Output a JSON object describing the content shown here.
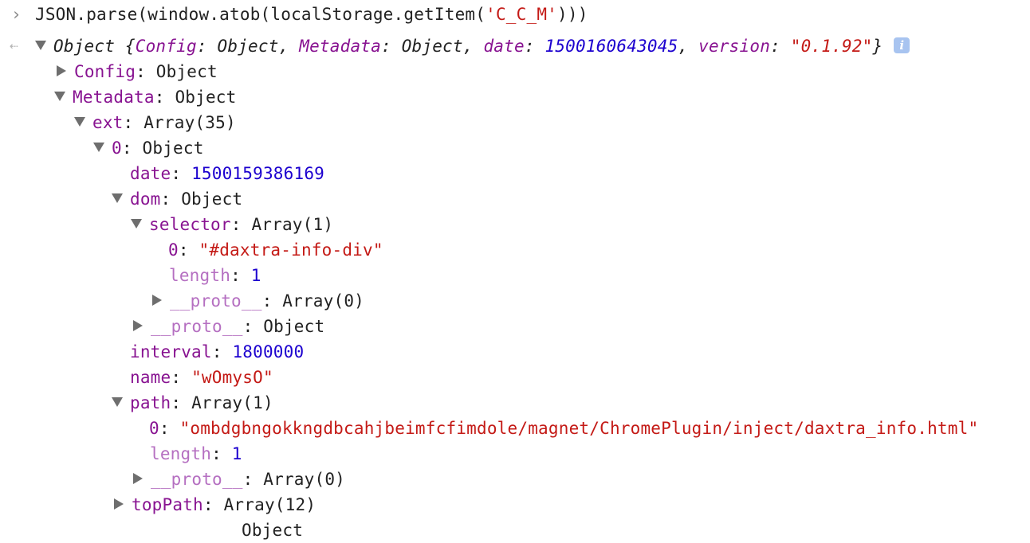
{
  "command": {
    "prefix": "JSON.parse(window.atob(localStorage.getItem(",
    "arg": "'C_C_M'",
    "suffix": ")))"
  },
  "preview": {
    "open": "Object {",
    "k1": "Config",
    "v1": "Object",
    "k2": "Metadata",
    "v2": "Object",
    "k3": "date",
    "v3": "1500160643045",
    "k4": "version",
    "v4": "\"0.1.92\"",
    "close": "}",
    "info": "i"
  },
  "tree": {
    "config": {
      "key": "Config",
      "value": "Object"
    },
    "metadata": {
      "key": "Metadata",
      "value": "Object"
    },
    "ext": {
      "key": "ext",
      "value": "Array(35)"
    },
    "item0": {
      "key": "0",
      "value": "Object"
    },
    "date": {
      "key": "date",
      "value": "1500159386169"
    },
    "dom": {
      "key": "dom",
      "value": "Object"
    },
    "selector": {
      "key": "selector",
      "value": "Array(1)"
    },
    "selector0": {
      "key": "0",
      "value": "\"#daxtra-info-div\""
    },
    "selectorLength": {
      "key": "length",
      "value": "1"
    },
    "selectorProto": {
      "key": "__proto__",
      "value": "Array(0)"
    },
    "domProto": {
      "key": "__proto__",
      "value": "Object"
    },
    "interval": {
      "key": "interval",
      "value": "1800000"
    },
    "name": {
      "key": "name",
      "value": "\"wOmysO\""
    },
    "path": {
      "key": "path",
      "value": "Array(1)"
    },
    "path0": {
      "key": "0",
      "value": "\"ombdgbngokkngdbcahjbeimfcfimdole/magnet/ChromePlugin/inject/daxtra_info.html\""
    },
    "pathLength": {
      "key": "length",
      "value": "1"
    },
    "pathProto": {
      "key": "__proto__",
      "value": "Array(0)"
    },
    "topPath": {
      "key": "topPath",
      "value": "Array(12)"
    },
    "nextPartial": {
      "value": "Object"
    }
  },
  "colors": {
    "key": "#881391",
    "keyDim": "#b56fc1",
    "number": "#1c00cf",
    "string": "#c41a16"
  },
  "icons": [
    "prompt-chevron-icon",
    "result-arrow-icon",
    "expand-triangle-icon",
    "collapse-triangle-icon",
    "info-icon"
  ]
}
